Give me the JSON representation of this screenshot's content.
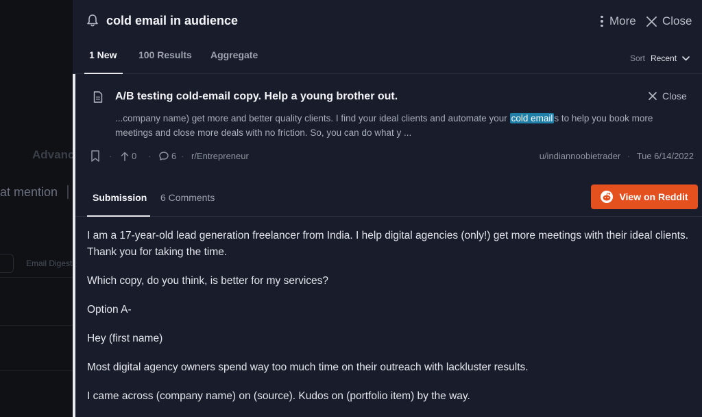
{
  "background": {
    "advanced_label": "Advanc",
    "mention_label": "at mention",
    "digest_label": "Email Digest"
  },
  "panel": {
    "title": "cold email in audience",
    "more_label": "More",
    "close_label": "Close",
    "tabs": [
      {
        "label": "1 New"
      },
      {
        "label": "100 Results"
      },
      {
        "label": "Aggregate"
      }
    ],
    "sort_label": "Sort",
    "sort_value": "Recent"
  },
  "result": {
    "title": "A/B testing cold-email copy. Help a young brother out.",
    "close_label": "Close",
    "snippet_before": "...company name) get more and better quality clients. I find your ideal clients and automate your ",
    "snippet_highlight": "cold email",
    "snippet_after": "s to help you book more meetings and close more deals with no friction. So, you can do what y ...",
    "upvotes": "0",
    "comments": "6",
    "subreddit": "r/Entrepreneur",
    "author": "u/indiannoobietrader",
    "date": "Tue 6/14/2022",
    "sub_tabs": [
      {
        "label": "Submission"
      },
      {
        "label": "6 Comments"
      }
    ],
    "view_button": "View on Reddit",
    "body": [
      "I am a 17-year-old lead generation freelancer from India. I help digital agencies (only!) get more meetings with their ideal clients. Thank you for taking the time.",
      "Which copy, do you think, is better for my services?",
      "Option A-",
      "Hey (first name)",
      "Most digital agency owners spend way too much time on their outreach with lackluster results.",
      "I came across (company name) on (source). Kudos on (portfolio item) by the way."
    ]
  },
  "colors": {
    "panel_bg": "#191c2a",
    "accent_highlight": "#1f7fa8",
    "reddit_orange": "#e4501e"
  }
}
